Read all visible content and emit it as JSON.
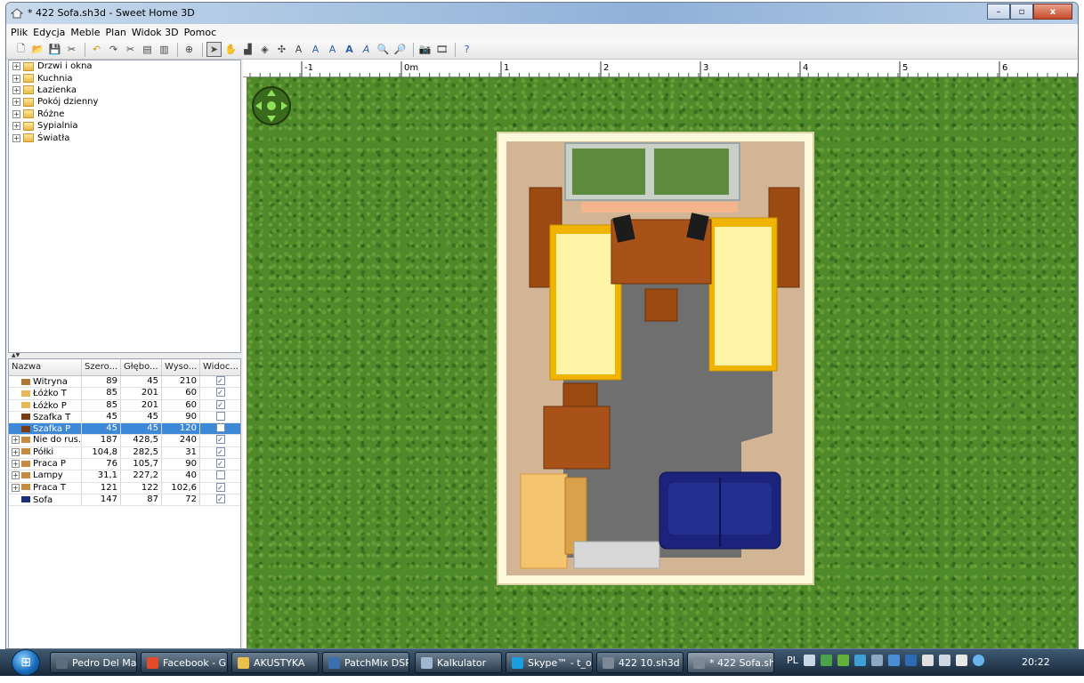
{
  "window": {
    "title": "* 422 Sofa.sh3d - Sweet Home 3D",
    "minimize": "–",
    "maximize": "▫",
    "close": "x"
  },
  "menu": [
    "Plik",
    "Edycja",
    "Meble",
    "Plan",
    "Widok 3D",
    "Pomoc"
  ],
  "toolbar_icons": [
    "new-icon",
    "open-icon",
    "save-icon",
    "cut-preferences-icon",
    "|",
    "undo-icon",
    "redo-icon",
    "cut-icon",
    "copy-icon",
    "paste-icon",
    "|",
    "add-furniture-icon",
    "|",
    "select-icon",
    "pan-icon",
    "create-walls-icon",
    "create-rooms-icon",
    "create-dimensions-icon",
    "add-text-icon",
    "text-style-1-icon",
    "text-style-2-icon",
    "text-style-3-icon",
    "text-style-4-icon",
    "zoom-in-icon",
    "zoom-out-icon",
    "|",
    "create-photo-icon",
    "create-video-icon",
    "|",
    "help-icon"
  ],
  "catalog": [
    "Drzwi i okna",
    "Kuchnia",
    "Łazienka",
    "Pokój dzienny",
    "Różne",
    "Sypialnia",
    "Światła"
  ],
  "furniture_table": {
    "headers": [
      "Nazwa",
      "Szero...",
      "Głębo...",
      "Wyso...",
      "Widoc..."
    ],
    "rows": [
      {
        "name": "Witryna",
        "w": "89",
        "d": "45",
        "h": "210",
        "visible": true,
        "group": false,
        "selected": false,
        "icon_color": "#b07a34"
      },
      {
        "name": "Łóżko T",
        "w": "85",
        "d": "201",
        "h": "60",
        "visible": true,
        "group": false,
        "selected": false,
        "icon_color": "#e6b85a"
      },
      {
        "name": "Łóżko P",
        "w": "85",
        "d": "201",
        "h": "60",
        "visible": true,
        "group": false,
        "selected": false,
        "icon_color": "#e6b85a"
      },
      {
        "name": "Szafka T",
        "w": "45",
        "d": "45",
        "h": "90",
        "visible": false,
        "group": false,
        "selected": false,
        "icon_color": "#7a3a14"
      },
      {
        "name": "Szafka P",
        "w": "45",
        "d": "45",
        "h": "120",
        "visible": false,
        "group": false,
        "selected": true,
        "icon_color": "#7a3a14"
      },
      {
        "name": "Nie do rus...",
        "w": "187",
        "d": "428,5",
        "h": "240",
        "visible": true,
        "group": true,
        "selected": false,
        "icon_color": "#c98b3e"
      },
      {
        "name": "Półki",
        "w": "104,8",
        "d": "282,5",
        "h": "31",
        "visible": true,
        "group": true,
        "selected": false,
        "icon_color": "#c98b3e"
      },
      {
        "name": "Praca P",
        "w": "76",
        "d": "105,7",
        "h": "90",
        "visible": true,
        "group": true,
        "selected": false,
        "icon_color": "#c98b3e"
      },
      {
        "name": "Lampy",
        "w": "31,1",
        "d": "227,2",
        "h": "40",
        "visible": false,
        "group": true,
        "selected": false,
        "icon_color": "#c98b3e"
      },
      {
        "name": "Praca T",
        "w": "121",
        "d": "122",
        "h": "102,6",
        "visible": true,
        "group": true,
        "selected": false,
        "icon_color": "#c98b3e"
      },
      {
        "name": "Sofa",
        "w": "147",
        "d": "87",
        "h": "72",
        "visible": true,
        "group": false,
        "selected": false,
        "icon_color": "#1b2f7a"
      }
    ]
  },
  "ruler": {
    "labels": [
      "-1",
      "0m",
      "1",
      "2",
      "3",
      "4",
      "5",
      "6"
    ]
  },
  "plan_colors": {
    "grass": "#4f8a2a",
    "floor": "#6f6f6f",
    "wall": "#fbf8dc",
    "carpet": "#d2b594",
    "wood": "#9b4a12",
    "bed": "#fff3a6",
    "bed_frame": "#f0b400",
    "sofa": "#1c237a"
  },
  "taskbar": {
    "tasks": [
      {
        "label": "Pedro Del Mar...",
        "color": "#5c6d7e"
      },
      {
        "label": "Facebook - G...",
        "color": "#e34b2b"
      },
      {
        "label": "AKUSTYKA",
        "color": "#e9c04d"
      },
      {
        "label": "PatchMix DSP",
        "color": "#3a6fb0"
      },
      {
        "label": "Kalkulator",
        "color": "#9fb7cf"
      },
      {
        "label": "Skype™ - t_o_...",
        "color": "#1a9ee0"
      },
      {
        "label": "422 10.sh3d - ...",
        "color": "#7c8896"
      },
      {
        "label": "* 422 Sofa.sh3...",
        "color": "#7c8896"
      }
    ],
    "language": "PL",
    "clock": "20:22"
  }
}
